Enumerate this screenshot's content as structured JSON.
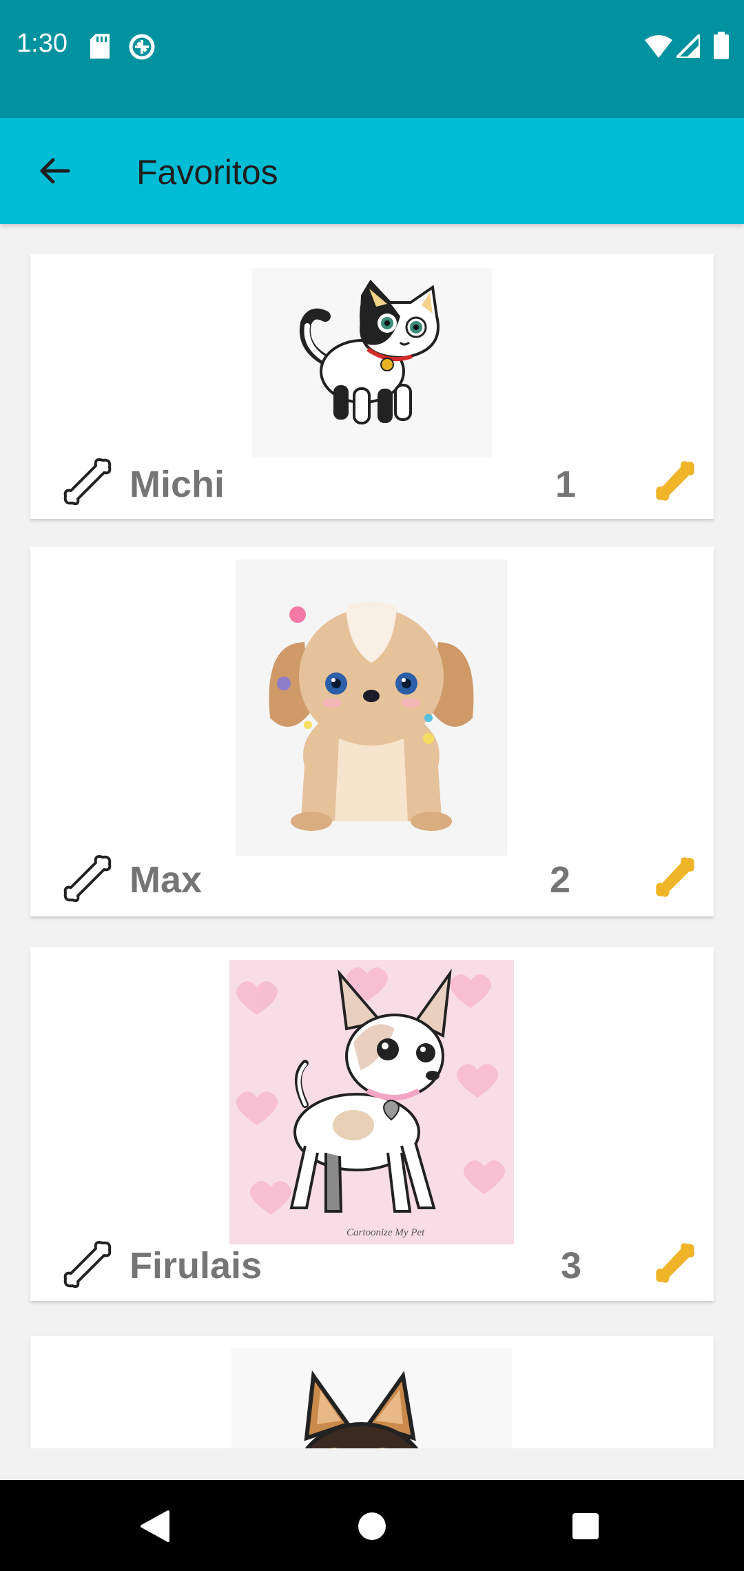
{
  "status_bar": {
    "time": "1:30",
    "icons_left": [
      "sd-card-icon",
      "data-saver-icon"
    ],
    "icons_right": [
      "wifi-icon",
      "signal-icon",
      "battery-icon"
    ]
  },
  "app_bar": {
    "back_icon": "arrow-back-icon",
    "title": "Favoritos",
    "color": "#00bcd4",
    "status_color": "#00939f"
  },
  "pets": [
    {
      "name": "Michi",
      "count": "1",
      "image": "cartoon-cat-image"
    },
    {
      "name": "Max",
      "count": "2",
      "image": "cartoon-puppy-image"
    },
    {
      "name": "Firulais",
      "count": "3",
      "image": "cartoon-chihuahua-image"
    },
    {
      "name": "",
      "count": "",
      "image": "cartoon-dog-image"
    }
  ],
  "colors": {
    "bone_accent": "#f0b429",
    "text_gray": "#757575"
  },
  "image_watermark": "Cartoonize My Pet",
  "nav_bar": {
    "back": "nav-back-icon",
    "home": "nav-home-icon",
    "recents": "nav-recents-icon"
  }
}
